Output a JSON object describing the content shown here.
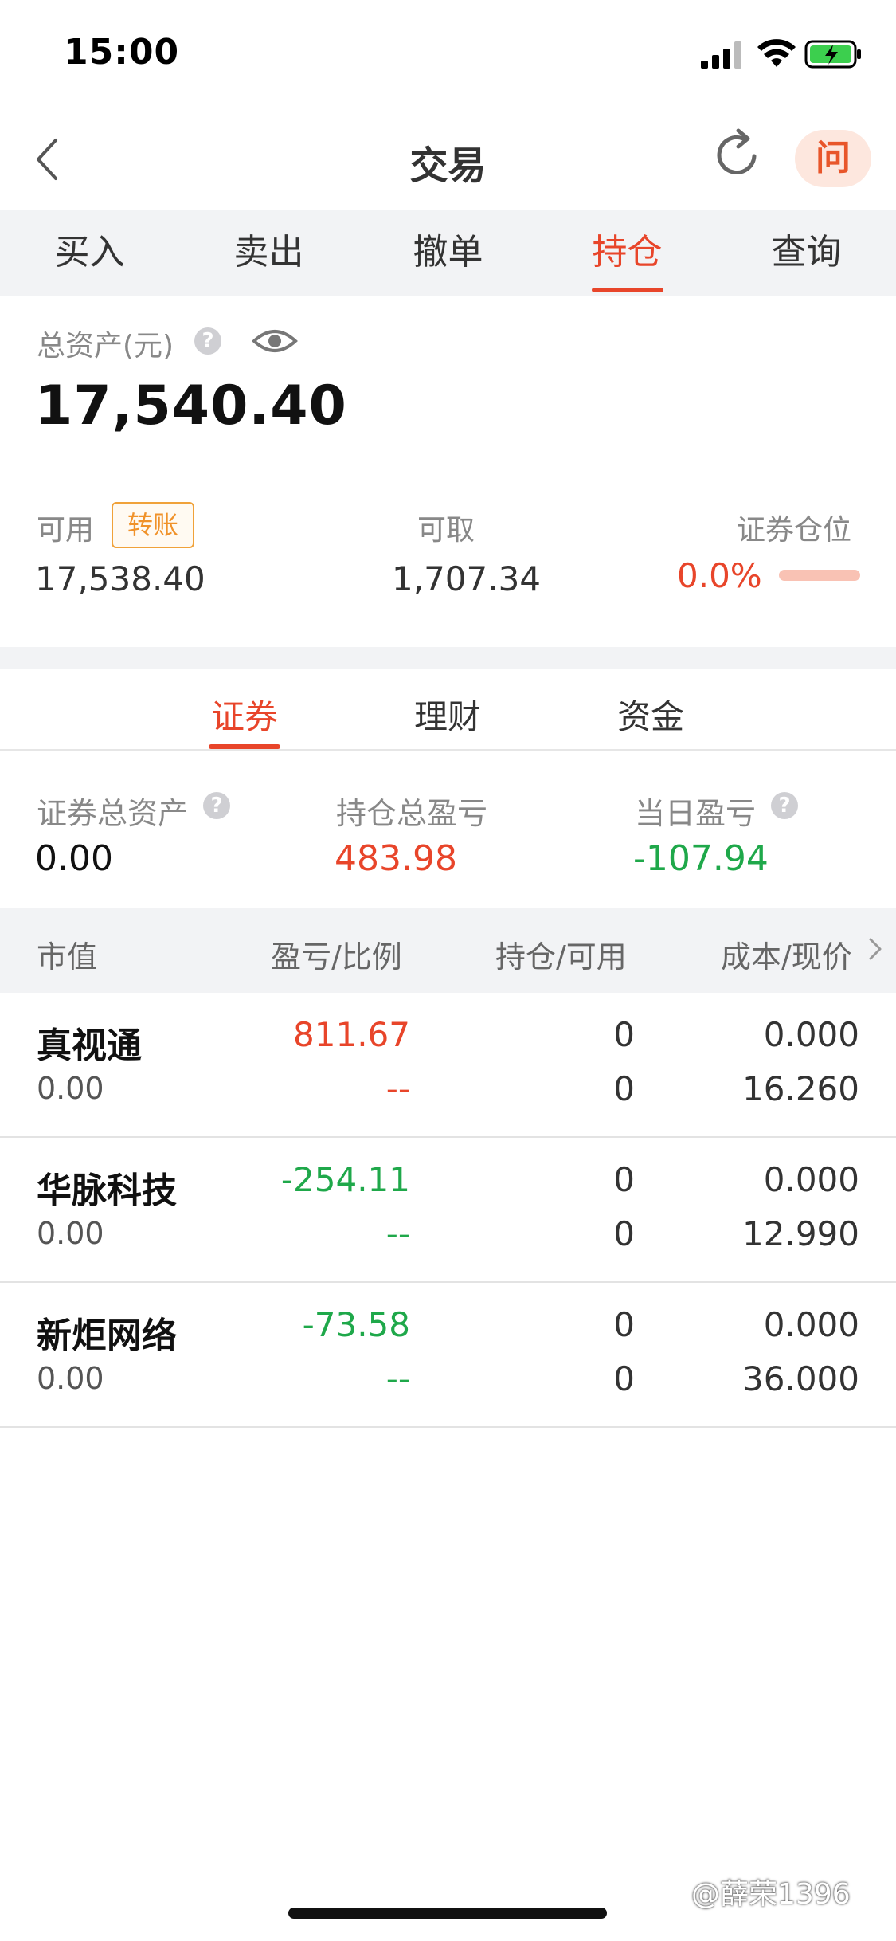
{
  "status": {
    "time": "15:00"
  },
  "nav": {
    "title": "交易",
    "ask_label": "问"
  },
  "top_tabs": [
    {
      "label": "买入"
    },
    {
      "label": "卖出"
    },
    {
      "label": "撤单"
    },
    {
      "label": "持仓"
    },
    {
      "label": "查询"
    }
  ],
  "assets": {
    "total_label": "总资产(元)",
    "total_value": "17,540.40",
    "available_label": "可用",
    "transfer_label": "转账",
    "available_value": "17,538.40",
    "withdrawable_label": "可取",
    "withdrawable_value": "1,707.34",
    "position_label": "证券仓位",
    "position_value": "0.0%"
  },
  "sub_tabs": [
    {
      "label": "证券"
    },
    {
      "label": "理财"
    },
    {
      "label": "资金"
    }
  ],
  "summary": {
    "securities_total_label": "证券总资产",
    "securities_total_value": "0.00",
    "holding_pl_label": "持仓总盈亏",
    "holding_pl_value": "483.98",
    "daily_pl_label": "当日盈亏",
    "daily_pl_value": "-107.94"
  },
  "table": {
    "headers": [
      "市值",
      "盈亏/比例",
      "持仓/可用",
      "成本/现价"
    ],
    "rows": [
      {
        "name": "真视通",
        "market_value": "0.00",
        "pl": "811.67",
        "ratio": "--",
        "holding": "0",
        "available": "0",
        "cost": "0.000",
        "price": "16.260"
      },
      {
        "name": "华脉科技",
        "market_value": "0.00",
        "pl": "-254.11",
        "ratio": "--",
        "holding": "0",
        "available": "0",
        "cost": "0.000",
        "price": "12.990"
      },
      {
        "name": "新炬网络",
        "market_value": "0.00",
        "pl": "-73.58",
        "ratio": "--",
        "holding": "0",
        "available": "0",
        "cost": "0.000",
        "price": "36.000"
      }
    ]
  },
  "watermark": "@薛荣1396",
  "colors": {
    "accent": "#e8452a",
    "loss": "#1fa84a",
    "transfer_border": "#f0a23a"
  }
}
